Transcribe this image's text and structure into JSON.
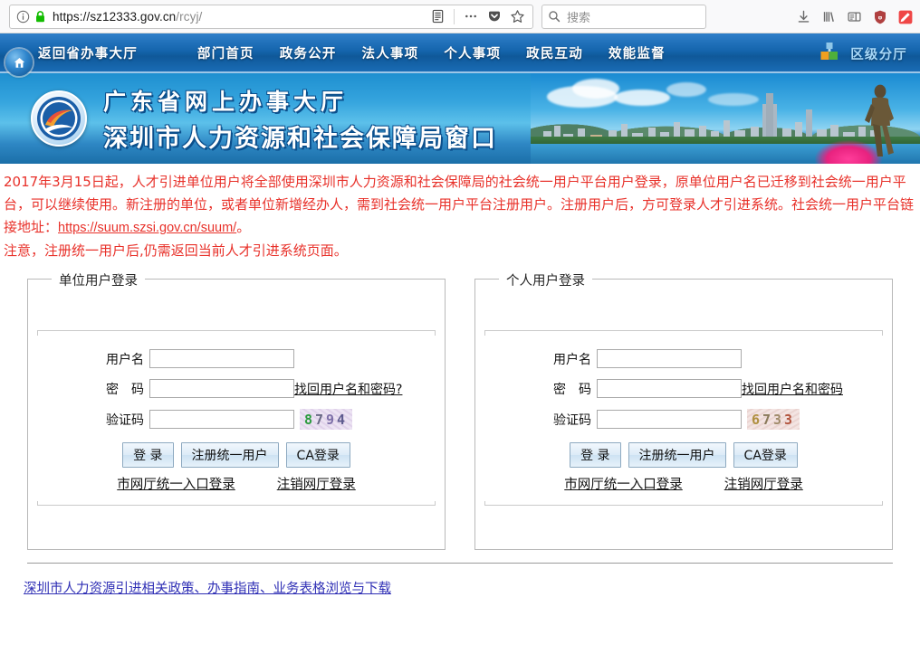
{
  "browser": {
    "url_host": "https://sz12333.gov.cn",
    "url_path": "/rcyj/",
    "search_placeholder": "搜索",
    "identity_icon": "info-circle-icon",
    "lock_icon": "padlock-secure-icon",
    "reader_icon": "reader-view-icon",
    "page_actions_icon": "page-actions-ellipsis-icon",
    "pocket_icon": "pocket-icon",
    "bookmark_icon": "bookmark-star-icon",
    "search_icon": "search-icon",
    "toolbar_icons": [
      "downloads-icon",
      "library-icon",
      "sidebar-icon",
      "ublock-origin-shield-icon",
      "extension-red-icon"
    ]
  },
  "site_nav": {
    "home_icon": "home-icon",
    "items": [
      {
        "label": "返回省办事大厅",
        "name": "nav-return-province-hall"
      },
      {
        "label": "部门首页",
        "name": "nav-department-home"
      },
      {
        "label": "政务公开",
        "name": "nav-government-affairs"
      },
      {
        "label": "法人事项",
        "name": "nav-legal-person-matters"
      },
      {
        "label": "个人事项",
        "name": "nav-personal-matters"
      },
      {
        "label": "政民互动",
        "name": "nav-public-interaction"
      },
      {
        "label": "效能监督",
        "name": "nav-efficiency-supervision"
      }
    ],
    "branch_label": "区级分厅",
    "branch_icon": "district-branch-building-icon",
    "bg_color": "#1565ad",
    "branch_text_color": "#a8d8f8"
  },
  "banner": {
    "title_line1": "广东省网上办事大厅",
    "title_line2": "深圳市人力资源和社会保障局窗口",
    "seal_icon": "government-seal-logo",
    "photo_alt": "shenzhen-skyline-photo"
  },
  "notice": {
    "color": "#e8312a",
    "paragraph1": "2017年3月15日起，人才引进单位用户将全部使用深圳市人力资源和社会保障局的社会统一用户平台用户登录，原单位用户名已迁移到社会统一用户平台，可以继续使用。新注册的单位，或者单位新增经办人，需到社会统一用户平台注册用户。注册用户后，方可登录人才引进系统。社会统一用户平台链接地址：",
    "link_text": "https://suum.szsi.gov.cn/suum/",
    "after_link": "。",
    "paragraph2": "注意，注册统一用户后,仍需返回当前人才引进系统页面。"
  },
  "login_unit": {
    "legend": "单位用户登录",
    "username_label": "用户名",
    "username_value": "",
    "password_label": "密　码",
    "password_value": "",
    "captcha_label": "验证码",
    "captcha_value": "",
    "captcha_image_text": "8794",
    "captcha_digits": [
      "8",
      "7",
      "9",
      "4"
    ],
    "forgot_link": "找回用户名和密码?",
    "buttons": [
      {
        "label": "登 录",
        "name": "login-button"
      },
      {
        "label": "注册统一用户",
        "name": "register-unified-user-button"
      },
      {
        "label": "CA登录",
        "name": "ca-login-button"
      }
    ],
    "links": [
      {
        "label": "市网厅统一入口登录",
        "name": "city-portal-unified-entry-login-link"
      },
      {
        "label": "注销网厅登录",
        "name": "logout-portal-login-link"
      }
    ]
  },
  "login_personal": {
    "legend": "个人用户登录",
    "username_label": "用户名",
    "username_value": "",
    "password_label": "密　码",
    "password_value": "",
    "captcha_label": "验证码",
    "captcha_value": "",
    "captcha_image_text": "6733",
    "captcha_digits": [
      "6",
      "7",
      "3",
      "3"
    ],
    "forgot_link": "找回用户名和密码",
    "buttons": [
      {
        "label": "登 录",
        "name": "login-button"
      },
      {
        "label": "注册统一用户",
        "name": "register-unified-user-button"
      },
      {
        "label": "CA登录",
        "name": "ca-login-button"
      }
    ],
    "links": [
      {
        "label": "市网厅统一入口登录",
        "name": "city-portal-unified-entry-login-link"
      },
      {
        "label": "注销网厅登录",
        "name": "logout-portal-login-link"
      }
    ]
  },
  "footer": {
    "link": "深圳市人力资源引进相关政策、办事指南、业务表格浏览与下载",
    "link_color": "#2f2fb5"
  }
}
